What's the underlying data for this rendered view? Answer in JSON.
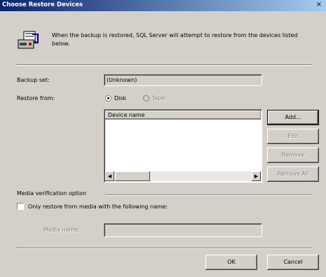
{
  "window": {
    "title": "Choose Restore Devices",
    "close_glyph": "×"
  },
  "header": {
    "message": "When the backup is restored, SQL Server will attempt to restore from the devices listed below."
  },
  "backup_set": {
    "label": "Backup set:",
    "value": "(Unknown)"
  },
  "restore_from": {
    "label": "Restore from:",
    "options": [
      {
        "label": "Disk",
        "checked": true,
        "enabled": true
      },
      {
        "label": "Tape",
        "checked": false,
        "enabled": false
      }
    ]
  },
  "device_list": {
    "column_header": "Device name",
    "rows": []
  },
  "side_buttons": [
    {
      "label": "Add...",
      "enabled": true
    },
    {
      "label": "Edit",
      "enabled": false
    },
    {
      "label": "Remove",
      "enabled": false
    },
    {
      "label": "Remove All",
      "enabled": false
    }
  ],
  "media_verification": {
    "group_label": "Media verification option",
    "checkbox_label": "Only restore from media with the following name:",
    "checked": false,
    "media_name_label": "Media name:",
    "media_name_value": ""
  },
  "footer": {
    "ok_label": "OK",
    "cancel_label": "Cancel"
  },
  "icons": {
    "header": "restore-device-icon"
  }
}
